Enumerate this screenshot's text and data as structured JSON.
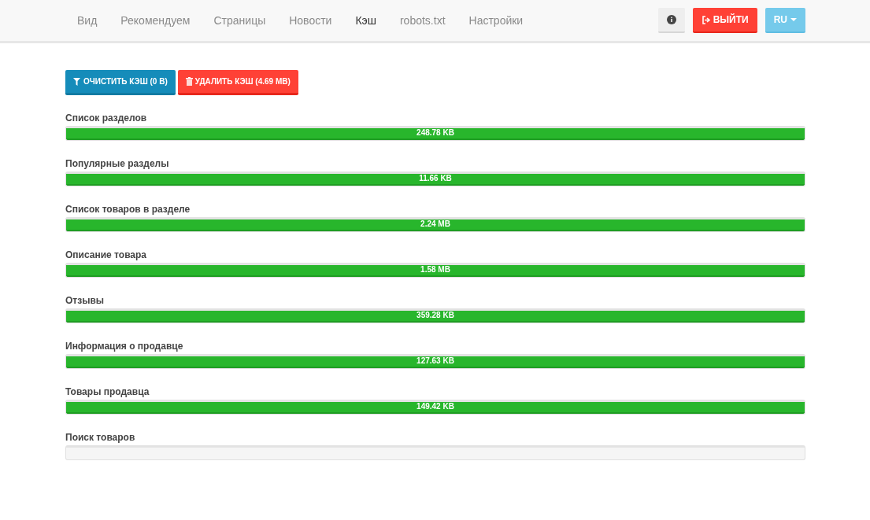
{
  "nav": {
    "items": [
      {
        "label": "Вид",
        "selected": false
      },
      {
        "label": "Рекомендуем",
        "selected": false
      },
      {
        "label": "Страницы",
        "selected": false
      },
      {
        "label": "Новости",
        "selected": false
      },
      {
        "label": "Кэш",
        "selected": true
      },
      {
        "label": "robots.txt",
        "selected": false
      },
      {
        "label": "Настройки",
        "selected": false
      }
    ],
    "logout": "ВЫЙТИ",
    "language": "RU"
  },
  "actions": {
    "clear": "ОЧИСТИТЬ КЭШ (0 B)",
    "delete": "УДАЛИТЬ КЭШ (4.69 MB)"
  },
  "caches": [
    {
      "name": "Список разделов",
      "level": 1,
      "reading": "248.78 KB"
    },
    {
      "name": "Популярные разделы",
      "level": 1,
      "reading": "11.66 KB"
    },
    {
      "name": "Список товаров в разделе",
      "level": 1,
      "reading": "2.24 MB"
    },
    {
      "name": "Описание товара",
      "level": 1,
      "reading": "1.58 MB"
    },
    {
      "name": "Отзывы",
      "level": 1,
      "reading": "359.28 KB"
    },
    {
      "name": "Информация о продавце",
      "level": 1,
      "reading": "127.63 KB"
    },
    {
      "name": "Товары продавца",
      "level": 1,
      "reading": "149.42 KB"
    },
    {
      "name": "Поиск товаров"
    }
  ]
}
